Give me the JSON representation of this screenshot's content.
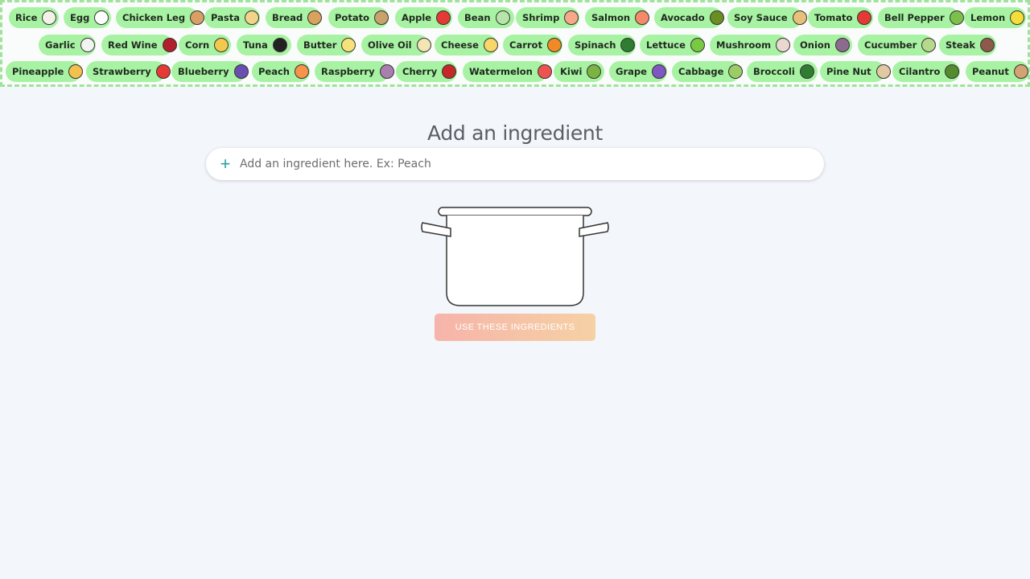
{
  "ingredient_rows": [
    [
      {
        "label": "Rice",
        "icon": "rice-bowl-icon",
        "color": "#f4f1e8"
      },
      {
        "label": "Egg",
        "icon": "egg-icon",
        "color": "#ffffff"
      },
      {
        "label": "Chicken Leg",
        "icon": "chicken-leg-icon",
        "color": "#d9a066"
      },
      {
        "label": "Pasta",
        "icon": "pasta-icon",
        "color": "#f2d38a"
      },
      {
        "label": "Bread",
        "icon": "bread-icon",
        "color": "#d9a25e"
      },
      {
        "label": "Potato",
        "icon": "potato-icon",
        "color": "#c9a26b"
      },
      {
        "label": "Apple",
        "icon": "apple-icon",
        "color": "#e53935"
      },
      {
        "label": "Bean",
        "icon": "bean-icon",
        "color": "#b7e4a8"
      },
      {
        "label": "Shrimp",
        "icon": "shrimp-icon",
        "color": "#f7a889"
      },
      {
        "label": "Salmon",
        "icon": "salmon-icon",
        "color": "#f48a6a"
      },
      {
        "label": "Avocado",
        "icon": "avocado-icon",
        "color": "#6b8e23"
      },
      {
        "label": "Soy Sauce",
        "icon": "soy-sauce-icon",
        "color": "#e8c07a"
      },
      {
        "label": "Tomato",
        "icon": "tomato-icon",
        "color": "#e53935"
      },
      {
        "label": "Bell Pepper",
        "icon": "bell-pepper-icon",
        "color": "#7cc04b"
      },
      {
        "label": "Lemon",
        "icon": "lemon-icon",
        "color": "#f5dd3b"
      }
    ],
    [
      {
        "label": "Garlic",
        "icon": "garlic-icon",
        "color": "#f3f3f3"
      },
      {
        "label": "Red Wine",
        "icon": "red-wine-icon",
        "color": "#b21f2d"
      },
      {
        "label": "Corn",
        "icon": "corn-icon",
        "color": "#f2c94c"
      },
      {
        "label": "Tuna",
        "icon": "tuna-icon",
        "color": "#222222"
      },
      {
        "label": "Butter",
        "icon": "butter-icon",
        "color": "#f7e27a"
      },
      {
        "label": "Olive Oil",
        "icon": "olive-oil-icon",
        "color": "#f3e6b3"
      },
      {
        "label": "Cheese",
        "icon": "cheese-icon",
        "color": "#f7d66a"
      },
      {
        "label": "Carrot",
        "icon": "carrot-icon",
        "color": "#f08a24"
      },
      {
        "label": "Spinach",
        "icon": "spinach-icon",
        "color": "#2e7d32"
      },
      {
        "label": "Lettuce",
        "icon": "lettuce-icon",
        "color": "#7ac943"
      },
      {
        "label": "Mushroom",
        "icon": "mushroom-icon",
        "color": "#e9d8d0"
      },
      {
        "label": "Onion",
        "icon": "onion-icon",
        "color": "#8c6b8f"
      },
      {
        "label": "Cucumber",
        "icon": "cucumber-icon",
        "color": "#b6d98b"
      },
      {
        "label": "Steak",
        "icon": "steak-icon",
        "color": "#8d5a4a"
      }
    ],
    [
      {
        "label": "Pineapple",
        "icon": "pineapple-icon",
        "color": "#f2c14e"
      },
      {
        "label": "Strawberry",
        "icon": "strawberry-icon",
        "color": "#e53935"
      },
      {
        "label": "Blueberry",
        "icon": "blueberry-icon",
        "color": "#6a4fb3"
      },
      {
        "label": "Peach",
        "icon": "peach-icon",
        "color": "#f7934a"
      },
      {
        "label": "Raspberry",
        "icon": "raspberry-icon",
        "color": "#a97fb0"
      },
      {
        "label": "Cherry",
        "icon": "cherry-icon",
        "color": "#c62828"
      },
      {
        "label": "Watermelon",
        "icon": "watermelon-icon",
        "color": "#ef5350"
      },
      {
        "label": "Kiwi",
        "icon": "kiwi-icon",
        "color": "#7cb342"
      },
      {
        "label": "Grape",
        "icon": "grape-icon",
        "color": "#7e57c2"
      },
      {
        "label": "Cabbage",
        "icon": "cabbage-icon",
        "color": "#9ccc65"
      },
      {
        "label": "Broccoli",
        "icon": "broccoli-icon",
        "color": "#2e7d32"
      },
      {
        "label": "Pine Nut",
        "icon": "pine-nut-icon",
        "color": "#e3c9a3"
      },
      {
        "label": "Cilantro",
        "icon": "cilantro-icon",
        "color": "#558b2f"
      },
      {
        "label": "Peanut",
        "icon": "peanut-icon",
        "color": "#d4a373"
      }
    ]
  ],
  "main": {
    "title": "Add an ingredient",
    "search_placeholder": "Add an ingredient here. Ex: Peach",
    "plus_icon": "+",
    "pot_icon": "cooking-pot-icon",
    "use_button_label": "USE THESE INGREDIENTS"
  },
  "colors": {
    "chip_bg": "#a8f2a3",
    "accent": "#2aa3a3",
    "button_gradient": [
      "#f6b4aa",
      "#f6d1a4"
    ]
  }
}
